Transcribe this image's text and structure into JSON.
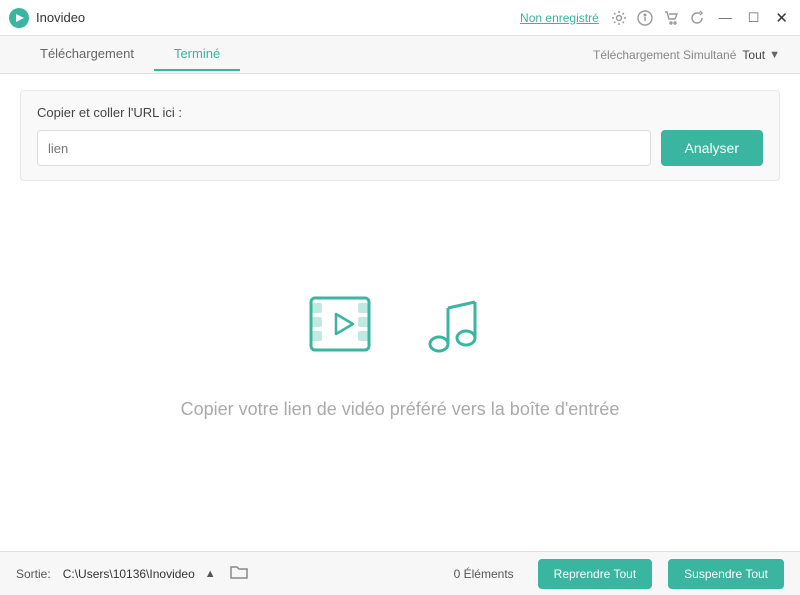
{
  "app": {
    "name": "Inovideo",
    "register_label": "Non enregistré"
  },
  "titlebar": {
    "icons": [
      "settings",
      "info",
      "cart",
      "refresh"
    ],
    "win_buttons": [
      "—",
      "☐",
      "✕"
    ]
  },
  "tabs": {
    "items": [
      {
        "id": "telechargement",
        "label": "Téléchargement",
        "active": false
      },
      {
        "id": "termine",
        "label": "Terminé",
        "active": true
      }
    ],
    "simultaneous_label": "Téléchargement Simultané",
    "tout_label": "Tout"
  },
  "url_section": {
    "label": "Copier et coller l'URL ici :",
    "input_placeholder": "lien",
    "analyze_button": "Analyser"
  },
  "empty_state": {
    "text": "Copier votre lien de vidéo préféré vers la boîte d'entrée"
  },
  "statusbar": {
    "sortie_label": "Sortie:",
    "sortie_path": "C:\\Users\\10136\\Inovideo",
    "elements_label": "0 Éléments",
    "resume_button": "Reprendre Tout",
    "pause_button": "Suspendre Tout"
  }
}
